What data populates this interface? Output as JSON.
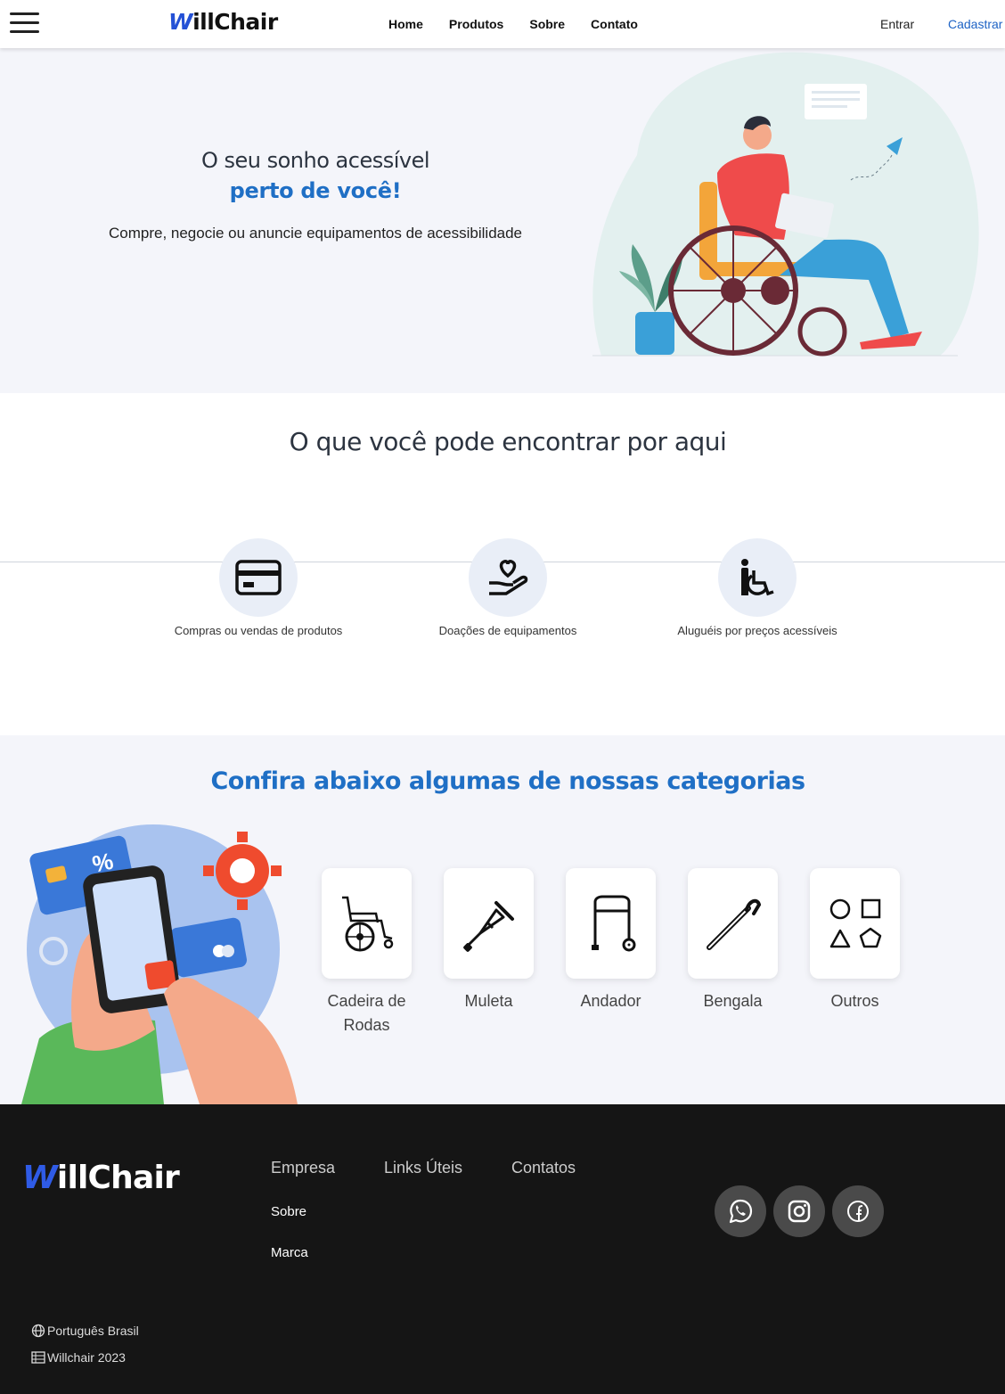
{
  "nav": {
    "logo_w": "W",
    "logo_rest": "illChair",
    "links": [
      "Home",
      "Produtos",
      "Sobre",
      "Contato"
    ],
    "login": "Entrar",
    "signup": "Cadastrar"
  },
  "hero": {
    "title_line1": "O seu sonho acessível",
    "title_line2": "perto de você!",
    "subtitle": "Compre, negocie ou anuncie equipamentos de acessibilidade"
  },
  "features": {
    "title": "O que você pode encontrar por aqui",
    "items": [
      {
        "label": "Compras ou vendas de produtos",
        "icon": "credit-card-icon"
      },
      {
        "label": "Doações de equipamentos",
        "icon": "donation-heart-hand-icon"
      },
      {
        "label": "Aluguéis por preços acessíveis",
        "icon": "wheelchair-accessible-icon"
      }
    ]
  },
  "categories": {
    "title": "Confira abaixo algumas de nossas categorias",
    "items": [
      {
        "label": "Cadeira de Rodas",
        "icon": "wheelchair-icon"
      },
      {
        "label": "Muleta",
        "icon": "crutch-icon"
      },
      {
        "label": "Andador",
        "icon": "walker-icon"
      },
      {
        "label": "Bengala",
        "icon": "cane-icon"
      },
      {
        "label": "Outros",
        "icon": "shapes-icon"
      }
    ]
  },
  "footer": {
    "logo_w": "W",
    "logo_rest": "illChair",
    "columns": [
      "Empresa",
      "Links Úteis",
      "Contatos"
    ],
    "company_links": [
      "Sobre",
      "Marca"
    ],
    "social": [
      "whatsapp-icon",
      "instagram-icon",
      "facebook-icon"
    ],
    "language": "Português Brasil",
    "copyright": "Willchair 2023"
  },
  "colors": {
    "brand_blue": "#1f6fc5",
    "logo_blue": "#2451d6",
    "footer_bg": "#151515",
    "hero_bg": "#f4f5fa"
  }
}
